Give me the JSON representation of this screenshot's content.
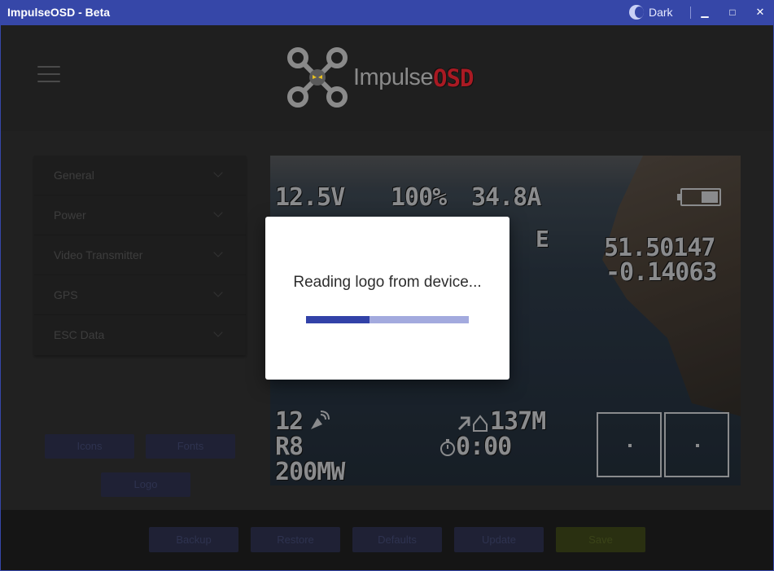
{
  "window": {
    "title": "ImpulseOSD - Beta",
    "theme_label": "Dark",
    "minimize": "▁",
    "maximize": "□",
    "close": "✕"
  },
  "header": {
    "logo_left": "Impulse",
    "logo_right": "OSD"
  },
  "sidebar": {
    "sections": [
      {
        "label": "General"
      },
      {
        "label": "Power"
      },
      {
        "label": "Video Transmitter"
      },
      {
        "label": "GPS"
      },
      {
        "label": "ESC Data"
      }
    ],
    "buttons": {
      "icons": "Icons",
      "fonts": "Fonts",
      "logo": "Logo"
    }
  },
  "osd_preview": {
    "voltage": "12.5V",
    "throttle": "100%",
    "current": "34.8A",
    "heading": "E",
    "lat": "51.50147",
    "lon": "-0.14063",
    "sats": "12",
    "channel": "R8",
    "power": "200MW",
    "home_distance": "137M",
    "timer": "0:00"
  },
  "footer": {
    "backup": "Backup",
    "restore": "Restore",
    "defaults": "Defaults",
    "update": "Update",
    "save": "Save"
  },
  "dialog": {
    "message": "Reading logo from device...",
    "progress": 0.39
  },
  "colors": {
    "titlebar": "#3647a8",
    "accent": "#3242a8",
    "brand_red": "#a91a23",
    "save": "#556321"
  }
}
